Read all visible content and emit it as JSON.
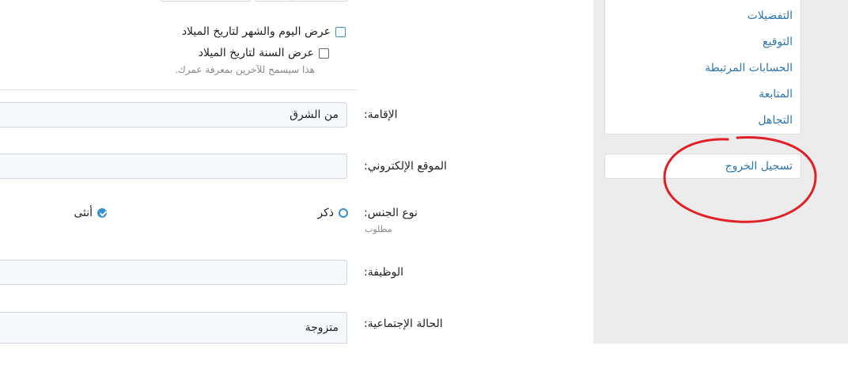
{
  "birthday": {
    "show_day_month": "عرض اليوم والشهر لتاريخ الميلاد",
    "show_year": "عرض السنة لتاريخ الميلاد",
    "hint": "هذا سيسمح للآخرين بمعرفة عمرك."
  },
  "fields": {
    "location": {
      "label": "الإقامة:",
      "value": "من الشرق"
    },
    "website": {
      "label": "الموقع الإلكتروني:",
      "value": ""
    },
    "gender": {
      "label": "نوع الجنس:",
      "required": "مطلوب",
      "options": [
        {
          "label": "ذكر",
          "checked": false
        },
        {
          "label": "أنثى",
          "checked": true
        }
      ]
    },
    "occupation": {
      "label": "الوظيفة:",
      "value": ""
    },
    "marital_status": {
      "label": "الحالة الإجتماعية:",
      "value": "متزوجة"
    }
  },
  "sidebar": {
    "items": [
      {
        "label": "التفضيلات"
      },
      {
        "label": "التوقيع"
      },
      {
        "label": "الحسابات المرتبطة"
      },
      {
        "label": "المتابعة"
      },
      {
        "label": "التجاهل"
      }
    ],
    "logout": "تسجيل الخروج"
  },
  "colors": {
    "link": "#2c75ad",
    "accent": "#3a8fd0",
    "annotation": "#e01f26",
    "sidebar_bg": "#ececec"
  }
}
